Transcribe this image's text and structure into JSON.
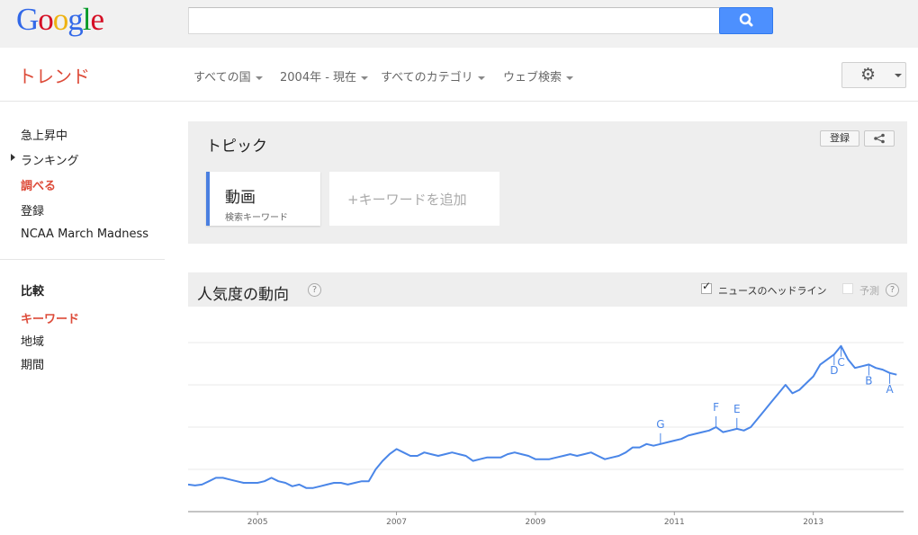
{
  "google": {
    "logo_letters": [
      {
        "ch": "G",
        "color": "#3369e8"
      },
      {
        "ch": "o",
        "color": "#d50f25"
      },
      {
        "ch": "o",
        "color": "#eeb211"
      },
      {
        "ch": "g",
        "color": "#3369e8"
      },
      {
        "ch": "l",
        "color": "#009925"
      },
      {
        "ch": "e",
        "color": "#d50f25"
      }
    ],
    "search_value": ""
  },
  "header": {
    "title": "トレンド",
    "filters": [
      "すべての国",
      "2004年 - 現在",
      "すべてのカテゴリ",
      "ウェブ検索"
    ]
  },
  "sidebar": {
    "items": [
      "急上昇中",
      "ランキング",
      "調べる",
      "登録",
      "NCAA March Madness"
    ],
    "compare_heading": "比較",
    "compare_items": [
      "キーワード",
      "地域",
      "期間"
    ]
  },
  "topic": {
    "title": "トピック",
    "subscribe_label": "登録",
    "keyword_term": "動画",
    "keyword_subtitle": "検索キーワード",
    "add_keyword_label": "+キーワードを追加"
  },
  "interest": {
    "title": "人気度の動向",
    "help_glyph": "?",
    "news_headlines_label": "ニュースのヘッドライン",
    "news_headlines_checked": true,
    "forecast_label": "予測",
    "forecast_checked": false
  },
  "chart_data": {
    "type": "line",
    "x_tick_labels": [
      "2005",
      "2007",
      "2009",
      "2011",
      "2013"
    ],
    "line_color": "#4a86e8",
    "grid": true,
    "series": [
      {
        "x": [
          2004.0,
          2004.1,
          2004.2,
          2004.3,
          2004.4,
          2004.5,
          2004.6,
          2004.7,
          2004.8,
          2004.9,
          2005.0,
          2005.1,
          2005.2,
          2005.3,
          2005.4,
          2005.5,
          2005.6,
          2005.7,
          2005.8,
          2005.9,
          2006.0,
          2006.1,
          2006.2,
          2006.3,
          2006.4,
          2006.5,
          2006.6,
          2006.7,
          2006.8,
          2006.9,
          2007.0,
          2007.1,
          2007.2,
          2007.3,
          2007.4,
          2007.5,
          2007.6,
          2007.7,
          2007.8,
          2007.9,
          2008.0,
          2008.1,
          2008.2,
          2008.3,
          2008.4,
          2008.5,
          2008.6,
          2008.7,
          2008.8,
          2008.9,
          2009.0,
          2009.1,
          2009.2,
          2009.3,
          2009.4,
          2009.5,
          2009.6,
          2009.7,
          2009.8,
          2009.9,
          2010.0,
          2010.1,
          2010.2,
          2010.3,
          2010.4,
          2010.5,
          2010.6,
          2010.7,
          2010.8,
          2010.9,
          2011.0,
          2011.1,
          2011.2,
          2011.3,
          2011.4,
          2011.5,
          2011.6,
          2011.7,
          2011.8,
          2011.9,
          2012.0,
          2012.1,
          2012.2,
          2012.3,
          2012.4,
          2012.5,
          2012.6,
          2012.7,
          2012.8,
          2012.9,
          2013.0,
          2013.1,
          2013.2,
          2013.3,
          2013.4,
          2013.5,
          2013.6,
          2013.7,
          2013.8,
          2013.9,
          2014.0,
          2014.1,
          2014.2
        ],
        "y": [
          16,
          15.5,
          16,
          18,
          20,
          20,
          19,
          18,
          17,
          17,
          17,
          18,
          20,
          18,
          17,
          15,
          16,
          14,
          14,
          15,
          16,
          17,
          17,
          16,
          17,
          18,
          18,
          25,
          30,
          34,
          37,
          35,
          33,
          33,
          35,
          34,
          33,
          34,
          35,
          34,
          33,
          30,
          31,
          32,
          32,
          32,
          34,
          35,
          34,
          33,
          31,
          31,
          31,
          32,
          33,
          34,
          33,
          34,
          35,
          33,
          31,
          32,
          33,
          35,
          38,
          38,
          40,
          39,
          40,
          41,
          42,
          43,
          45,
          46,
          47,
          48,
          50,
          47,
          48,
          49,
          48,
          50,
          55,
          60,
          65,
          70,
          75,
          70,
          72,
          76,
          80,
          87,
          90,
          93,
          98,
          90,
          85,
          86,
          87,
          85,
          84,
          82,
          81
        ],
        "annotations": [
          {
            "label": "A",
            "x": 2014.1
          },
          {
            "label": "B",
            "x": 2013.8
          },
          {
            "label": "C",
            "x": 2013.4
          },
          {
            "label": "D",
            "x": 2013.3
          },
          {
            "label": "E",
            "x": 2011.9
          },
          {
            "label": "F",
            "x": 2011.6
          },
          {
            "label": "G",
            "x": 2010.8
          }
        ]
      }
    ]
  }
}
